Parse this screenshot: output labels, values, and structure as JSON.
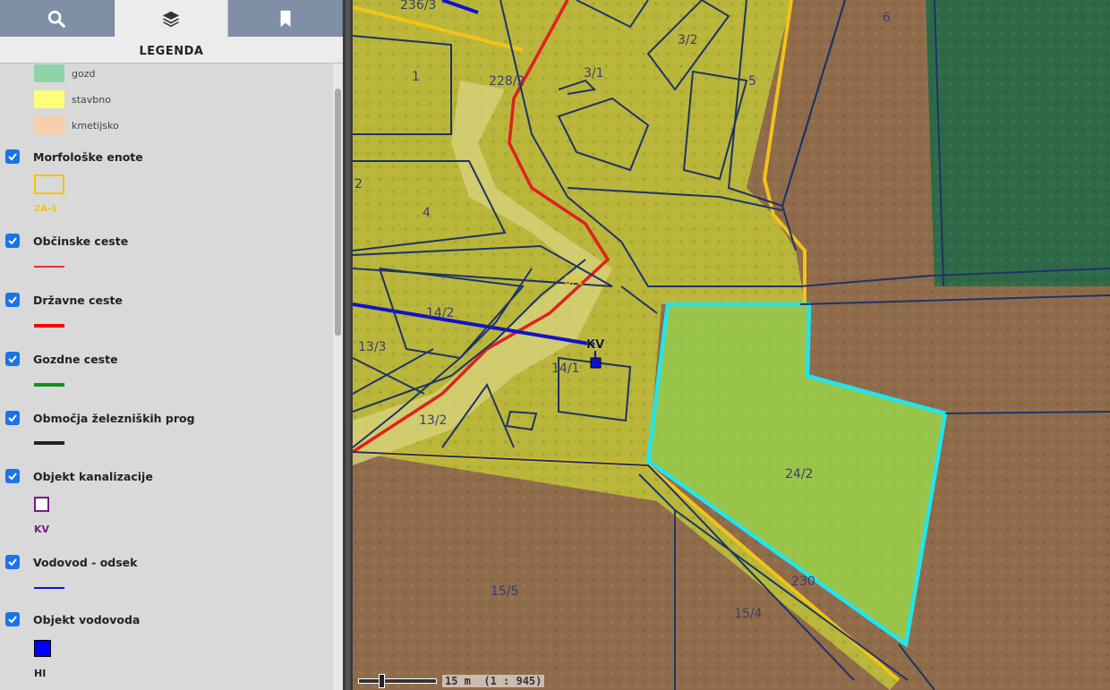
{
  "tabs": [
    {
      "name": "search",
      "icon": "search-icon"
    },
    {
      "name": "layers",
      "icon": "layers-icon"
    },
    {
      "name": "bookmarks",
      "icon": "bookmark-icon"
    }
  ],
  "legend": {
    "title": "LEGENDA",
    "land_use": [
      {
        "label": "gozd",
        "color": "#8fd4a8"
      },
      {
        "label": "stavbno",
        "color": "#ffff7a"
      },
      {
        "label": "kmetijsko",
        "color": "#f6cfa8"
      }
    ],
    "layers": [
      {
        "label": "Morfološke enote",
        "checked": true,
        "symbol_label": "2A-1",
        "symbol_color": "#f4c20d"
      },
      {
        "label": "Občinske ceste",
        "checked": true,
        "symbol_color": "#e53030"
      },
      {
        "label": "Državne ceste",
        "checked": true,
        "symbol_color": "#ff0000"
      },
      {
        "label": "Gozdne ceste",
        "checked": true,
        "symbol_color": "#12921a"
      },
      {
        "label": "Območja železniških prog",
        "checked": true,
        "symbol_color": "#222222"
      },
      {
        "label": "Objekt kanalizacije",
        "checked": true,
        "symbol_label": "KV",
        "symbol_color": "#7a1a8a"
      },
      {
        "label": "Vodovod - odsek",
        "checked": true,
        "symbol_color": "#1010d0"
      },
      {
        "label": "Objekt vodovoda",
        "checked": true,
        "symbol_label": "HI",
        "symbol_color": "#0000ff"
      }
    ]
  },
  "map": {
    "parcels": [
      "236/3",
      "6",
      "3/2",
      "228/2",
      "3/1",
      "5",
      "1",
      "2",
      "4",
      "8/1",
      "14/2",
      "13/3",
      "14/1",
      "13/2",
      "24/2",
      "230",
      "15/5",
      "15/4"
    ],
    "feature_labels": {
      "sewer_object": "KV"
    },
    "highlight_color": "#22e5ee",
    "scale": {
      "distance": "15 m",
      "ratio": "(1 : 945)"
    }
  }
}
